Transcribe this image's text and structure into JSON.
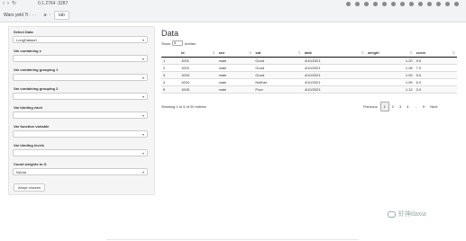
{
  "browser": {
    "url": "0.1.2764 :3287",
    "tabs": [
      "Wars yeld Ti  ·  ·  ·",
      "a·  ·",
      "tab"
    ],
    "ext_colors": [
      "#888888",
      "#888888",
      "#888888",
      "#888888",
      "#888888",
      "#888888",
      "#888888",
      "#888888",
      "#888888",
      "#888888",
      "#888888",
      "#888888",
      "#888888"
    ]
  },
  "sidebar": {
    "fields": [
      {
        "label": "Select Data",
        "value": "LongDataset"
      },
      {
        "label": "Var containing x",
        "value": ""
      },
      {
        "label": "Var containing grouping 1",
        "value": ""
      },
      {
        "label": "Var containing grouping 2",
        "value": ""
      },
      {
        "label": "Var binding each",
        "value": ""
      },
      {
        "label": "Var function variable",
        "value": ""
      },
      {
        "label": "Var binding levels",
        "value": ""
      },
      {
        "label": "Count weights to G",
        "value": "NA/da"
      }
    ],
    "button_label": "Adopt choices"
  },
  "main": {
    "title": "Data",
    "show_label": "Show",
    "show_value": "5",
    "entries_label": "entries",
    "columns": [
      "",
      "id",
      "sex",
      "sat",
      "date",
      "weight",
      "score"
    ],
    "rows": [
      [
        "1",
        "1001",
        "male",
        "Good",
        "4/10/2021",
        "1.20",
        "9.0"
      ],
      [
        "2",
        "1002",
        "male",
        "Good",
        "4/10/2021",
        "1.08",
        "7.0"
      ],
      [
        "3",
        "1003",
        "male",
        "Good",
        "4/10/2021",
        "1.00",
        "5.0"
      ],
      [
        "4",
        "1004",
        "male",
        "Neither",
        "4/10/2021",
        "1.05",
        "6.0"
      ],
      [
        "5",
        "1005",
        "male",
        "Poor",
        "4/10/2021",
        "1.12",
        "3.0"
      ]
    ],
    "info": "Showing 1 to 5 of 20 entries",
    "pager": [
      "Previous",
      "1",
      "2",
      "3",
      "4",
      "...",
      "9",
      "Next"
    ]
  },
  "watermark": "虾神daxia"
}
